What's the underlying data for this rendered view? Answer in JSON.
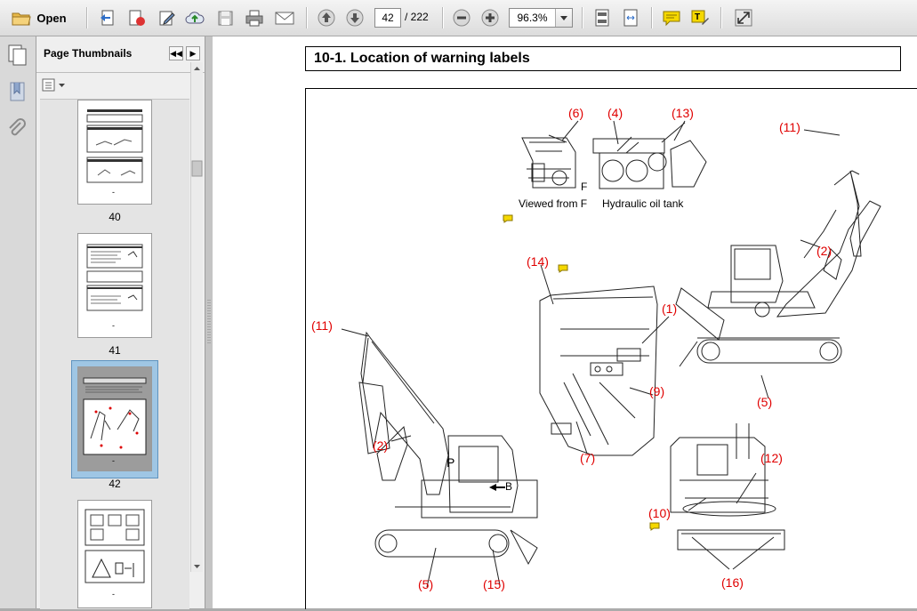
{
  "toolbar": {
    "open_label": "Open",
    "current_page": "42",
    "page_total": "/ 222",
    "zoom": "96.3%"
  },
  "panel": {
    "title": "Page Thumbnails",
    "thumbnails": [
      {
        "label": "40",
        "dash": "-"
      },
      {
        "label": "41",
        "dash": "-"
      },
      {
        "label": "42",
        "dash": "-"
      },
      {
        "label": "",
        "dash": "-"
      }
    ]
  },
  "document": {
    "heading": "10-1. Location of warning labels",
    "captions": {
      "viewed_from": "Viewed from F",
      "hydraulic": "Hydraulic oil tank",
      "f_marker": "F",
      "p_marker": "P",
      "b_marker": "B"
    },
    "labels": {
      "l6": "(6)",
      "l4": "(4)",
      "l13": "(13)",
      "l11_top": "(11)",
      "l2_right": "(2)",
      "l14": "(14)",
      "l1": "(1)",
      "l11_left": "(11)",
      "l9": "(9)",
      "l5_right": "(5)",
      "l2_left": "(2)",
      "l7": "(7)",
      "l12": "(12)",
      "l10": "(10)",
      "l5_bottom": "(5)",
      "l15": "(15)",
      "l16": "(16)"
    },
    "label_color": "#e00000"
  },
  "colors": {
    "toolbar_bg": "#e8e8e8",
    "selected_thumb": "#9fc6e4",
    "note_icon": "#f5d800"
  }
}
